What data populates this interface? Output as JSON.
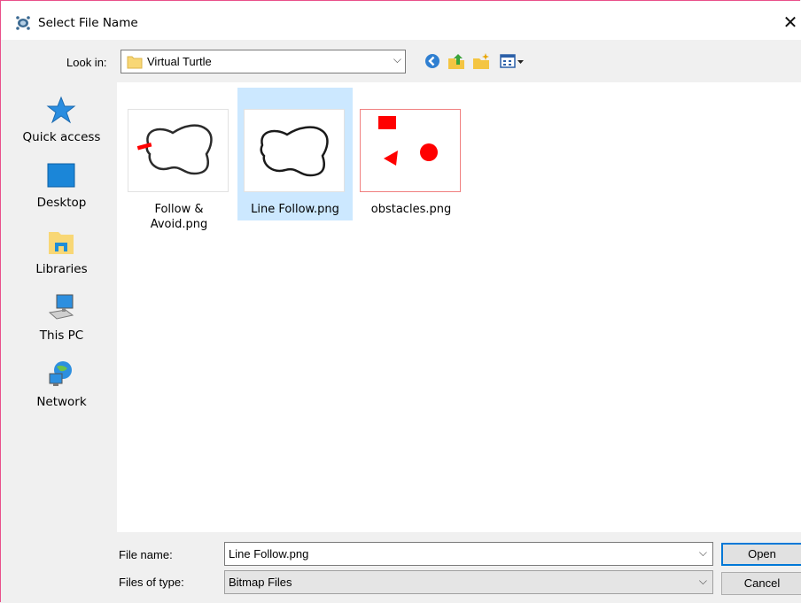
{
  "window": {
    "title": "Select File Name",
    "close_glyph": "✕"
  },
  "lookin": {
    "label": "Look in:",
    "value": "Virtual Turtle"
  },
  "toolbar": {
    "icons": [
      "back-icon",
      "up-folder-icon",
      "new-folder-icon",
      "view-menu-icon"
    ]
  },
  "places": [
    {
      "label": "Quick access",
      "icon": "quick-access-icon"
    },
    {
      "label": "Desktop",
      "icon": "desktop-icon"
    },
    {
      "label": "Libraries",
      "icon": "libraries-icon"
    },
    {
      "label": "This PC",
      "icon": "this-pc-icon"
    },
    {
      "label": "Network",
      "icon": "network-icon"
    }
  ],
  "files": [
    {
      "name": "Follow & Avoid.png",
      "name_line1": "Follow &",
      "name_line2": "Avoid.png",
      "selected": false
    },
    {
      "name": "Line Follow.png",
      "selected": true
    },
    {
      "name": "obstacles.png",
      "selected": false
    }
  ],
  "footer": {
    "file_name_label": "File name:",
    "file_name_value": "Line Follow.png",
    "type_label": "Files of type:",
    "type_value": "Bitmap Files",
    "open_label": "Open",
    "cancel_label": "Cancel"
  },
  "colors": {
    "accent": "#0078d7",
    "selection": "#cce8ff",
    "window_border": "#e94f8a",
    "obstacle_red": "#ff0000"
  }
}
